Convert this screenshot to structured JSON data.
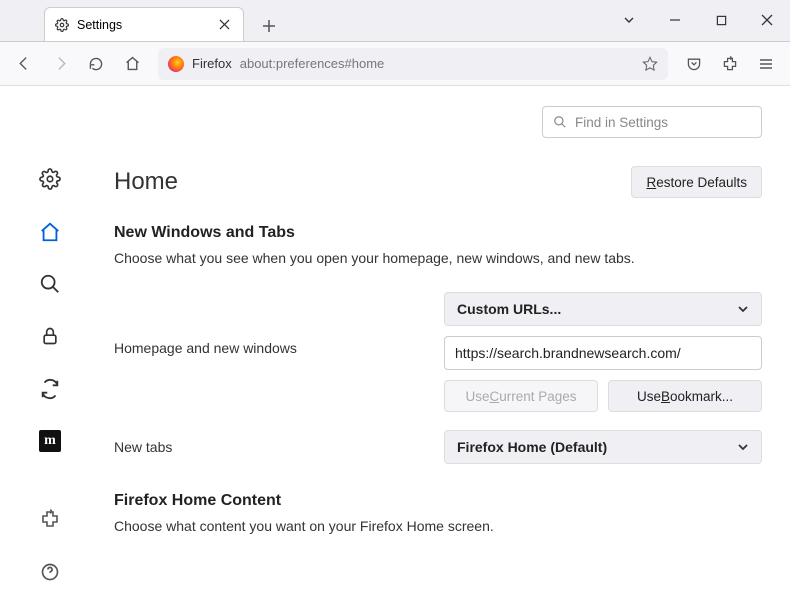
{
  "tab": {
    "title": "Settings"
  },
  "urlbar": {
    "label": "Firefox",
    "value": "about:preferences#home"
  },
  "search": {
    "placeholder": "Find in Settings"
  },
  "page": {
    "title": "Home",
    "restore": "Restore Defaults",
    "section1_title": "New Windows and Tabs",
    "section1_desc": "Choose what you see when you open your homepage, new windows, and new tabs.",
    "homepage_label": "Homepage and new windows",
    "homepage_select": "Custom URLs...",
    "homepage_url": "https://search.brandnewsearch.com/",
    "use_current": "Use Current Pages",
    "use_bookmark": "Use Bookmark...",
    "newtabs_label": "New tabs",
    "newtabs_select": "Firefox Home (Default)",
    "section2_title": "Firefox Home Content",
    "section2_desc": "Choose what content you want on your Firefox Home screen."
  }
}
